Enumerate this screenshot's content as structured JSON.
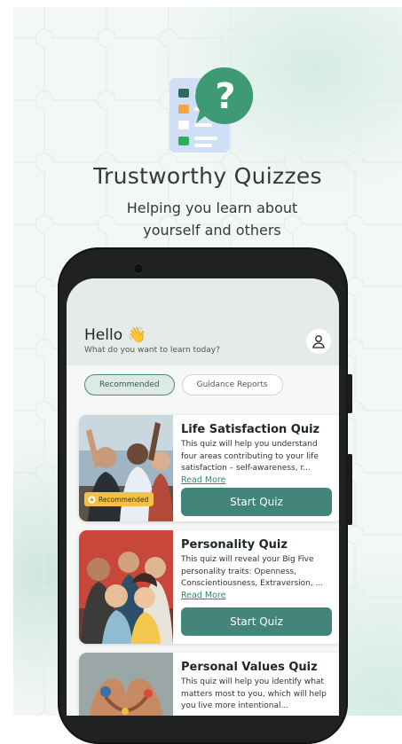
{
  "hero": {
    "title": "Trustworthy Quizzes",
    "subtitle": "Helping you learn about yourself and others",
    "icon": "quiz-question-icon"
  },
  "app": {
    "greeting": "Hello 👋",
    "prompt": "What do you want to learn today?",
    "profile_icon": "user-icon"
  },
  "tabs": [
    {
      "label": "Recommended",
      "active": true
    },
    {
      "label": "Guidance Reports",
      "active": false
    }
  ],
  "quizzes": [
    {
      "title": "Life Satisfaction Quiz",
      "description": "This quiz will help you understand four areas contributing to your life satisfaction – self-awareness, r...",
      "read_more": "Read More",
      "button": "Start Quiz",
      "badge": "Recommended"
    },
    {
      "title": "Personality Quiz",
      "description": "This quiz will reveal your Big Five personality traits: Openness, Conscientiousness, Extraversion, ...",
      "read_more": "Read More",
      "button": "Start Quiz"
    },
    {
      "title": "Personal Values Quiz",
      "description": "This quiz will help you identify what matters most to you, which will help you live more intentional..."
    }
  ],
  "colors": {
    "accent": "#43857a",
    "badge": "#f6c047",
    "background": "#f3f7f5"
  }
}
